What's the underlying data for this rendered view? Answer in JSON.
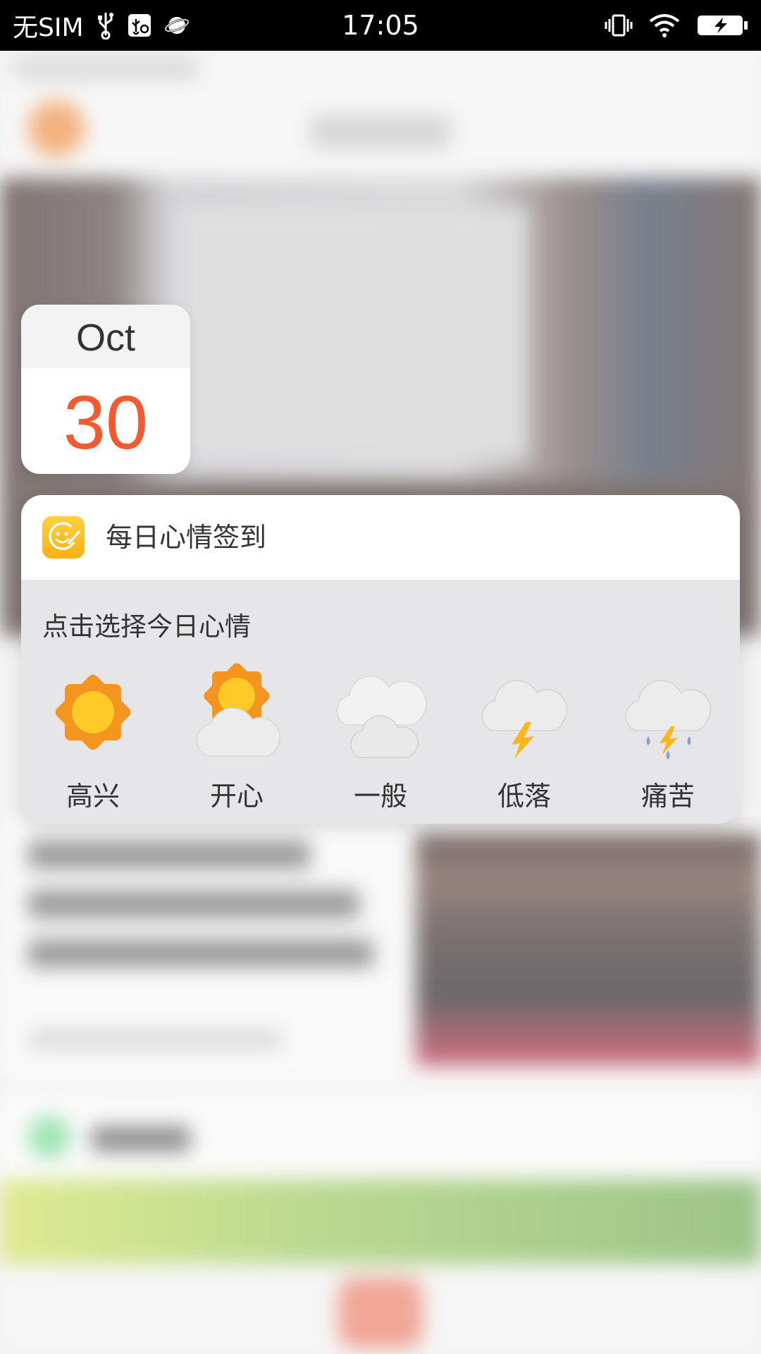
{
  "status_bar": {
    "carrier": "无SIM",
    "time": "17:05",
    "icons": [
      "usb-icon",
      "usb-debug-icon",
      "planet-icon",
      "vibrate-icon",
      "wifi-icon",
      "battery-charging-icon"
    ]
  },
  "date_card": {
    "month": "Oct",
    "day": "30"
  },
  "mood_widget": {
    "title": "每日心情签到",
    "prompt": "点击选择今日心情",
    "options": [
      {
        "label": "高兴",
        "icon": "sunny-icon"
      },
      {
        "label": "开心",
        "icon": "partly-sunny-icon"
      },
      {
        "label": "一般",
        "icon": "cloudy-icon"
      },
      {
        "label": "低落",
        "icon": "thunder-cloud-icon"
      },
      {
        "label": "痛苦",
        "icon": "thunderstorm-rain-icon"
      }
    ]
  },
  "colors": {
    "accent_day": "#f4592f",
    "app_icon": "#fbb011",
    "sun_outer": "#f4951f",
    "sun_inner": "#ffc928"
  }
}
